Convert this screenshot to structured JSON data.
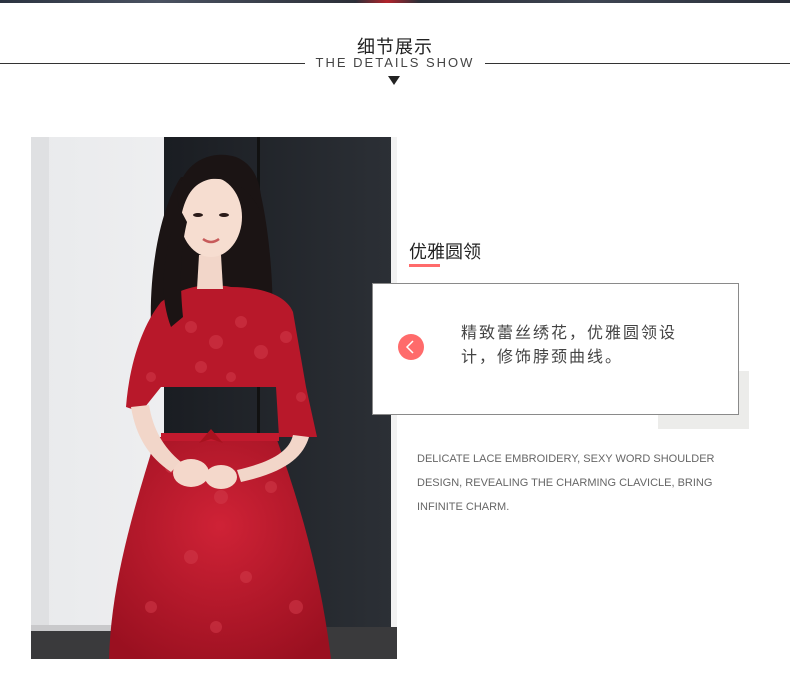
{
  "header": {
    "title_zh": "细节展示",
    "title_en": "THE DETAILS SHOW"
  },
  "photo": {
    "subject": "woman-in-red-lace-dress"
  },
  "feature": {
    "heading": "优雅圆领",
    "description_zh": "精致蕾丝绣花，优雅圆领设计，修饰脖颈曲线。",
    "description_en": "DELICATE LACE EMBROIDERY, SEXY WORD SHOULDER DESIGN, REVEALING THE CHARMING CLAVICLE, BRING INFINITE CHARM."
  },
  "colors": {
    "accent": "#ff6b6b",
    "dress_red": "#b8182a",
    "text_dark": "#222222"
  },
  "icons": {
    "nav": "chevron-left-icon",
    "title_marker": "triangle-down-icon"
  }
}
